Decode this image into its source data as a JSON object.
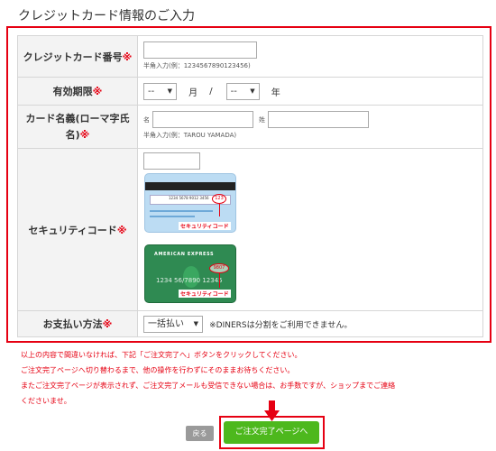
{
  "page_title": "クレジットカード情報のご入力",
  "required_mark": "※",
  "card_number": {
    "label": "クレジットカード番号",
    "value": "",
    "hint": "半角入力(例：1234567890123456)"
  },
  "expiry": {
    "label": "有効期限",
    "month_value": "--",
    "month_unit": "月",
    "separator": "/",
    "year_value": "--",
    "year_unit": "年"
  },
  "card_name": {
    "label_line1": "カード名義(ローマ字氏",
    "label_line2": "名)",
    "first_name_label": "名",
    "last_name_label": "姓",
    "first_value": "",
    "last_value": "",
    "hint": "半角入力(例：TAROU YAMADA)"
  },
  "security_code": {
    "label": "セキュリティコード",
    "value": "",
    "card1": {
      "number_text": "1234 5678 9012 3456",
      "cvv_text": "123",
      "caption": "セキュリティコード"
    },
    "card2": {
      "brand_text": "AMERICAN EXPRESS",
      "number_text": "1234 56/7890 12345",
      "cvv_text": "9807",
      "caption": "セキュリティコード"
    }
  },
  "payment": {
    "label": "お支払い方法",
    "selected": "一括払い",
    "note": "※DINERSは分割をご利用できません。"
  },
  "notice": {
    "line1": "以上の内容で間違いなければ、下記「ご注文完了へ」ボタンをクリックしてください。",
    "line2": "ご注文完了ページへ切り替わるまで、他の操作を行わずにそのままお待ちください。",
    "line3": "またご注文完了ページが表示されず、ご注文完了メールも受信できない場合は、お手数ですが、ショップまでご連絡",
    "line4": "くださいませ。"
  },
  "buttons": {
    "back": "戻る",
    "complete": "ご注文完了ページへ"
  },
  "colors": {
    "accent_red": "#e60012",
    "button_green": "#4db81d",
    "back_gray": "#9a9a9a"
  }
}
